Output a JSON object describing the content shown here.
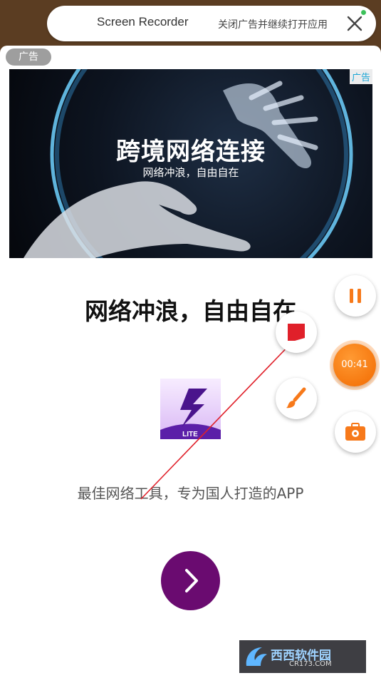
{
  "top_bar": {
    "app_name": "Screen Recorder",
    "close_ad_text": "关闭广告并继续打开应用"
  },
  "ad": {
    "tag": "广告",
    "hero_ad_tag": "广告",
    "hero_title": "跨境网络连接",
    "hero_subtitle": "网络冲浪，自由自在",
    "headline": "网络冲浪，自由自在",
    "app_badge": "LITE",
    "slogan": "最佳网络工具，专为国人打造的APP"
  },
  "recorder_controls": {
    "timer": "00:41",
    "buttons": [
      "pause-icon",
      "stop-icon",
      "brush-icon",
      "toolbox-icon"
    ]
  },
  "watermark": {
    "text": "西西软件园",
    "sub": "CR173.COM"
  },
  "colors": {
    "accent_orange": "#f7791a",
    "button_purple": "#6a0b70",
    "annotation_red": "#e0202a",
    "status_green": "#3cc15a"
  }
}
